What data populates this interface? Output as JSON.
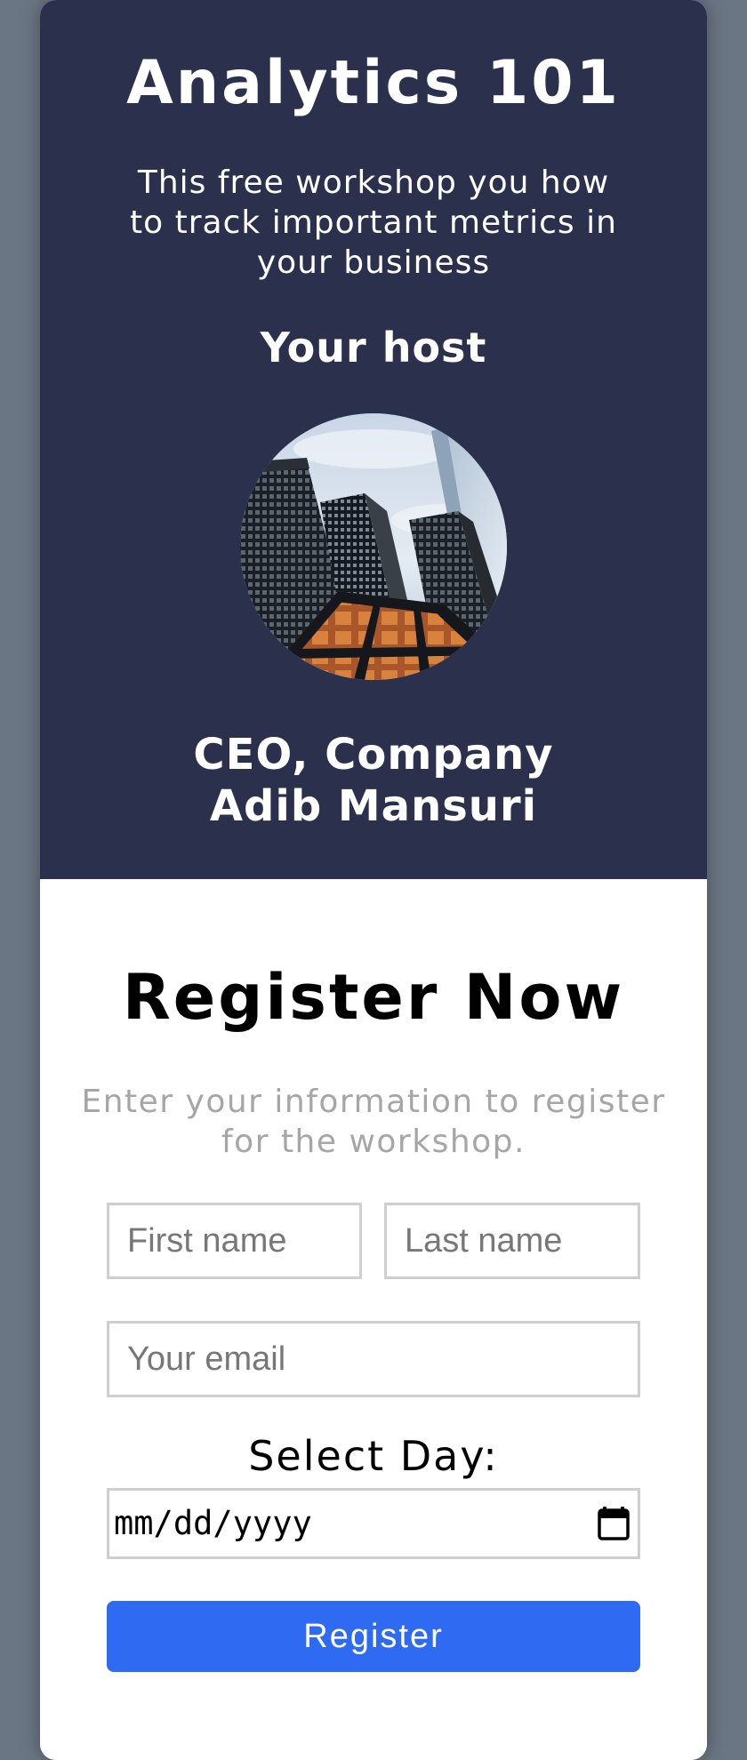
{
  "hero": {
    "title": "Analytics 101",
    "description": "This free workshop you how to track important metrics in your business",
    "host_heading": "Your host",
    "host_title": "CEO, Company",
    "host_name": "Adib Mansuri",
    "background_color": "#2b314d"
  },
  "registration": {
    "title": "Register Now",
    "description": "Enter your information to register for the workshop.",
    "first_name_placeholder": "First name",
    "last_name_placeholder": "Last name",
    "email_placeholder": "Your email",
    "select_day_label": "Select Day:",
    "date_placeholder": "mm/dd/yyyy",
    "date_icon": "calendar-icon",
    "submit_label": "Register",
    "button_color": "#2f6bf2"
  },
  "page": {
    "background_color": "#6b7684"
  }
}
